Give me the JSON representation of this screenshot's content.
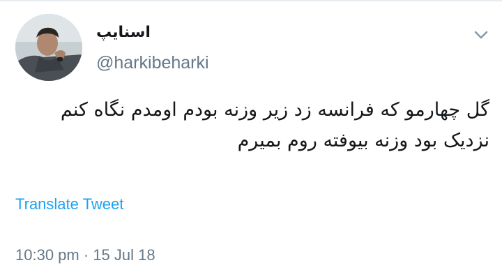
{
  "author": {
    "display_name": "اسنایپ",
    "handle": "@harkibeharki",
    "avatar_icon": "profile-photo"
  },
  "tweet": {
    "text": "گل چهارمو که فرانسه زد زیر وزنه بودم اومدم نگاه کنم نزدیک بود وزنه بیوفته روم بمیرم",
    "translate_label": "Translate Tweet",
    "time": "10:30 pm",
    "separator": "·",
    "date": "15 Jul 18"
  },
  "icons": {
    "menu": "chevron-down-icon"
  },
  "colors": {
    "link": "#1da1f2",
    "secondary_text": "#657786",
    "primary_text": "#14171a"
  }
}
